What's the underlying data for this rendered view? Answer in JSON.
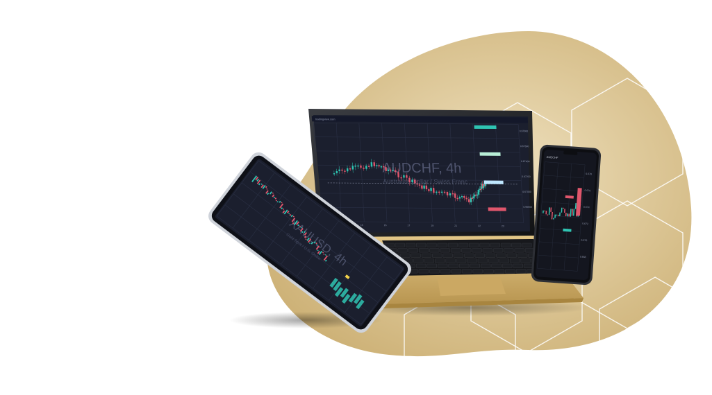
{
  "colors": {
    "blob": "#d9c08a",
    "blob_light": "#efe1bf",
    "hexagon_stroke": "#ffffff",
    "screen_bg": "#1b1f2e",
    "grid": "#2a3045",
    "candle_up": "#2fc4b2",
    "candle_down": "#e0566c",
    "laptop_body": "#d8b56e",
    "keyboard": "#17181c"
  },
  "laptop": {
    "chart_title": "AUDCHF, 4h",
    "chart_subtitle": "Australian Dollar / Swiss Franc",
    "header_text": "tradingview.com",
    "price_labels": [
      "0.67800",
      "0.67600",
      "0.67400",
      "0.67200",
      "0.67000",
      "0.66800"
    ],
    "date_labels": [
      "14",
      "15",
      "16",
      "17",
      "18",
      "21",
      "22",
      "23"
    ]
  },
  "tablet": {
    "chart_title": "XAUUSD, 4h",
    "chart_subtitle": "Gold Spot / U.S. Dollar"
  },
  "phone": {
    "symbol": "AUDCHF",
    "price_labels": [
      "0.678",
      "0.676",
      "0.674",
      "0.672",
      "0.670",
      "0.668"
    ]
  }
}
